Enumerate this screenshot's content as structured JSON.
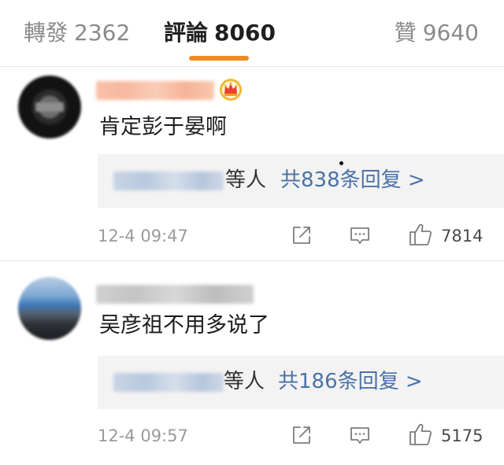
{
  "tabs": {
    "repost": {
      "label": "轉發",
      "count": "2362"
    },
    "comments": {
      "label": "評論",
      "count": "8060"
    },
    "likes": {
      "label": "贊",
      "count": "9640"
    }
  },
  "colors": {
    "accent_underline": "#f08a24",
    "link_blue": "#4a72a8",
    "crown": "#f5a623"
  },
  "comments": [
    {
      "text": "肯定彭于晏啊",
      "reply_suffix": "等人",
      "reply_link": "共838条回复 >",
      "timestamp": "12-4 09:47",
      "likes": "7814",
      "badge_icon": "crown-icon"
    },
    {
      "text": "吴彦祖不用多说了",
      "reply_suffix": "等人",
      "reply_link": "共186条回复 >",
      "timestamp": "12-4 09:57",
      "likes": "5175"
    }
  ]
}
